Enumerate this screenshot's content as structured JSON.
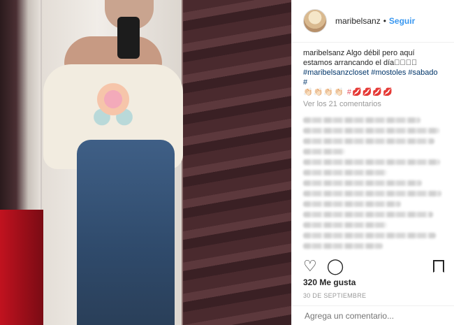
{
  "post": {
    "username": "maribelsanz",
    "dot": "•",
    "follow_label": "Seguir"
  },
  "caption": {
    "username": "maribelsanz",
    "text": "Algo débil pero aquí estamos arrancando el día🏻🏻🏻🏻",
    "hashtags": "#maribelsanzcloset #mostoles #sabado #",
    "emoji_line": "👏🏻👏🏻👏🏻👏🏻 #💋💋💋💋"
  },
  "comments": {
    "view_all": "Ver los 21 comentarios"
  },
  "stats": {
    "likes": "320 Me gusta",
    "date": "30 DE SEPTIEMBRE"
  },
  "comment_box": {
    "placeholder": "Agrega un comentario..."
  },
  "icons": {
    "like": "heart-icon",
    "comment": "comment-icon",
    "save": "bookmark-icon"
  },
  "colors": {
    "follow": "#3897f0",
    "hashtag": "#003569",
    "muted": "#999999"
  }
}
